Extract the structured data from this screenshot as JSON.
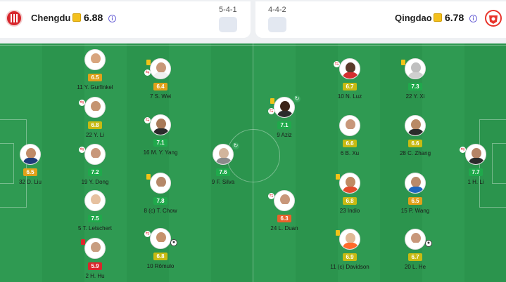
{
  "home": {
    "name": "Chengdu",
    "rating": "6.88",
    "formation": "5-4-1",
    "crest_color": "#d7262c"
  },
  "away": {
    "name": "Qingdao",
    "rating": "6.78",
    "formation": "4-4-2",
    "crest_color": "#e8342b"
  },
  "players": [
    {
      "label": "11 Y. Gurfinkel",
      "rating": "6.5",
      "skin": "#d8a57e",
      "kit": "#ffffff",
      "events": []
    },
    {
      "label": "7 S. Wei",
      "rating": "6.4",
      "skin": "#c89878",
      "kit": "#f0f0f0",
      "events": [
        "yellow-card",
        "sub-off"
      ]
    },
    {
      "label": "22 Y. Li",
      "rating": "6.8",
      "skin": "#c59470",
      "kit": "#ffffff",
      "events": [
        "sub-off"
      ]
    },
    {
      "label": "16 M. Y. Yang",
      "rating": "7.1",
      "skin": "#a87a58",
      "kit": "#2b2b2b",
      "events": [
        "sub-off"
      ]
    },
    {
      "label": "32 D. Liu",
      "rating": "6.5",
      "skin": "#c08b68",
      "kit": "#1e3b7a",
      "events": []
    },
    {
      "label": "19 Y. Dong",
      "rating": "7.2",
      "skin": "#c8977a",
      "kit": "#ffffff",
      "events": [
        "sub-off"
      ]
    },
    {
      "label": "8 (c) T. Chow",
      "rating": "7.8",
      "skin": "#b58868",
      "kit": "#ffffff",
      "events": [
        "yellow-card"
      ]
    },
    {
      "label": "9 F. Silva",
      "rating": "7.6",
      "skin": "#d2b59c",
      "kit": "#8a8a8a",
      "events": [
        "assist"
      ]
    },
    {
      "label": "5 T. Letschert",
      "rating": "7.5",
      "skin": "#e6c1a0",
      "kit": "#ffffff",
      "events": []
    },
    {
      "label": "2 H. Hu",
      "rating": "5.9",
      "skin": "#c89d80",
      "kit": "#ffffff",
      "events": [
        "red-card"
      ]
    },
    {
      "label": "10 Rômulo",
      "rating": "6.8",
      "skin": "#c6926c",
      "kit": "#ffffff",
      "events": [
        "sub-off",
        "goal"
      ]
    },
    {
      "label": "10 N. Luz",
      "rating": "6.7",
      "skin": "#5a3a2a",
      "kit": "#d22f2f",
      "events": [
        "sub-off"
      ]
    },
    {
      "label": "22 Y. Xi",
      "rating": "7.3",
      "skin": "#bfbfbf",
      "kit": "#cfcfcf",
      "events": [
        "yellow-card"
      ]
    },
    {
      "label": "9 Aziz",
      "rating": "7.1",
      "skin": "#3b2418",
      "kit": "#2b2b2b",
      "events": [
        "yellow-card",
        "sub-off",
        "assist"
      ]
    },
    {
      "label": "6 B. Xu",
      "rating": "6.6",
      "skin": "#c8977a",
      "kit": "#ffffff",
      "events": []
    },
    {
      "label": "28 C. Zhang",
      "rating": "6.6",
      "skin": "#b88a66",
      "kit": "#2b2b2b",
      "events": []
    },
    {
      "label": "1 H. Li",
      "rating": "7.7",
      "skin": "#b58466",
      "kit": "#2b2b2b",
      "events": [
        "sub-off"
      ]
    },
    {
      "label": "23 Indio",
      "rating": "6.8",
      "skin": "#c08a62",
      "kit": "#e34c2c",
      "events": [
        "yellow-card"
      ]
    },
    {
      "label": "15 P. Wang",
      "rating": "6.5",
      "skin": "#b98a6a",
      "kit": "#1e66c0",
      "events": []
    },
    {
      "label": "24 L. Duan",
      "rating": "6.3",
      "skin": "#c8977a",
      "kit": "#ffffff",
      "events": [
        "sub-off"
      ]
    },
    {
      "label": "11 (c) Davidson",
      "rating": "6.9",
      "skin": "#e0b896",
      "kit": "#ff6b2c",
      "events": [
        "yellow-card"
      ]
    },
    {
      "label": "20 L. He",
      "rating": "6.7",
      "skin": "#c8977a",
      "kit": "#ffffff",
      "events": [
        "goal"
      ]
    }
  ],
  "colors": {
    "rating_high": "#1fa94b",
    "rating_mid": "#c7ba12",
    "rating_ok": "#e0a11a",
    "rating_low": "#e9612a",
    "rating_bad": "#d9262c"
  }
}
